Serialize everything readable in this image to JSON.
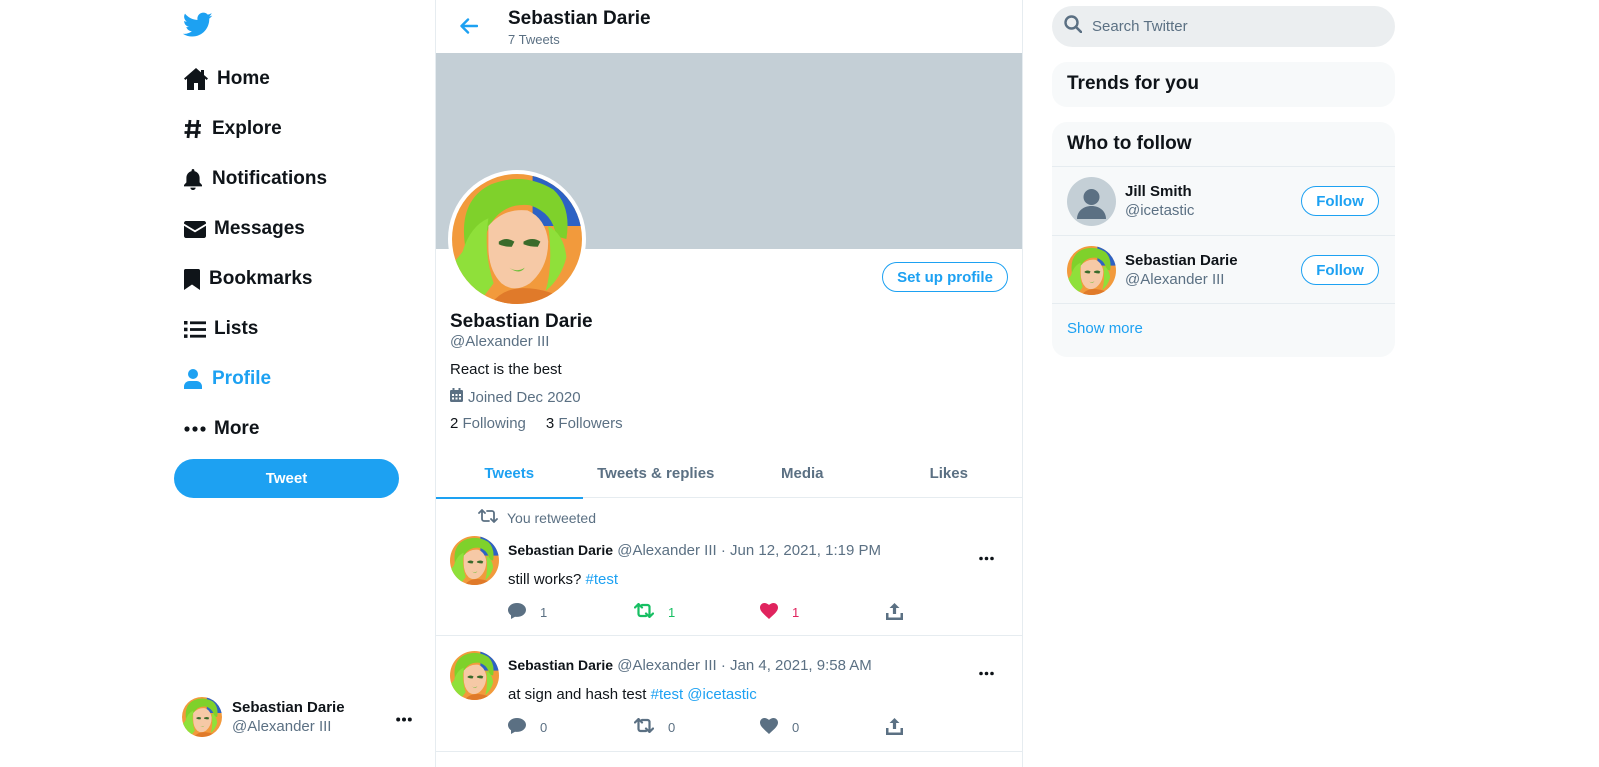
{
  "colors": {
    "accent": "#1da1f2",
    "retweet": "#17bf63",
    "like": "#e0245e",
    "banner": "#c4cfd6"
  },
  "nav": {
    "items": [
      {
        "label": "Home",
        "icon": "home-icon"
      },
      {
        "label": "Explore",
        "icon": "hashtag-icon"
      },
      {
        "label": "Notifications",
        "icon": "bell-icon"
      },
      {
        "label": "Messages",
        "icon": "envelope-icon"
      },
      {
        "label": "Bookmarks",
        "icon": "bookmark-icon"
      },
      {
        "label": "Lists",
        "icon": "list-icon"
      },
      {
        "label": "Profile",
        "icon": "user-icon",
        "active": true
      },
      {
        "label": "More",
        "icon": "more-dots-icon"
      }
    ],
    "tweet_button": "Tweet"
  },
  "account": {
    "name": "Sebastian Darie",
    "handle": "@Alexander III"
  },
  "header": {
    "title": "Sebastian Darie",
    "tweet_count": "7 Tweets"
  },
  "profile": {
    "setup_button": "Set up profile",
    "name": "Sebastian Darie",
    "handle": "@Alexander III",
    "bio": "React is the best",
    "joined": "Joined Dec 2020",
    "following_count": "2",
    "following_label": "Following",
    "followers_count": "3",
    "followers_label": "Followers"
  },
  "tabs": [
    "Tweets",
    "Tweets & replies",
    "Media",
    "Likes"
  ],
  "tweets": [
    {
      "retweet_label": "You retweeted",
      "name": "Sebastian Darie",
      "handle": "@Alexander III",
      "sep": "·",
      "date": "Jun 12, 2021, 1:19 PM",
      "text": "still works? ",
      "tags": "#test",
      "replies": "1",
      "retweets": "1",
      "likes": "1",
      "retweeted": true,
      "liked": true
    },
    {
      "name": "Sebastian Darie",
      "handle": "@Alexander III",
      "sep": "·",
      "date": "Jan 4, 2021, 9:58 AM",
      "text": "at sign and hash test ",
      "tags": "#test @icetastic",
      "replies": "0",
      "retweets": "0",
      "likes": "0",
      "retweeted": false,
      "liked": false
    }
  ],
  "search": {
    "placeholder": "Search Twitter"
  },
  "trends": {
    "title": "Trends for you"
  },
  "who_to_follow": {
    "title": "Who to follow",
    "users": [
      {
        "name": "Jill Smith",
        "handle": "@icetastic",
        "button": "Follow"
      },
      {
        "name": "Sebastian Darie",
        "handle": "@Alexander III",
        "button": "Follow"
      }
    ],
    "show_more": "Show more"
  }
}
